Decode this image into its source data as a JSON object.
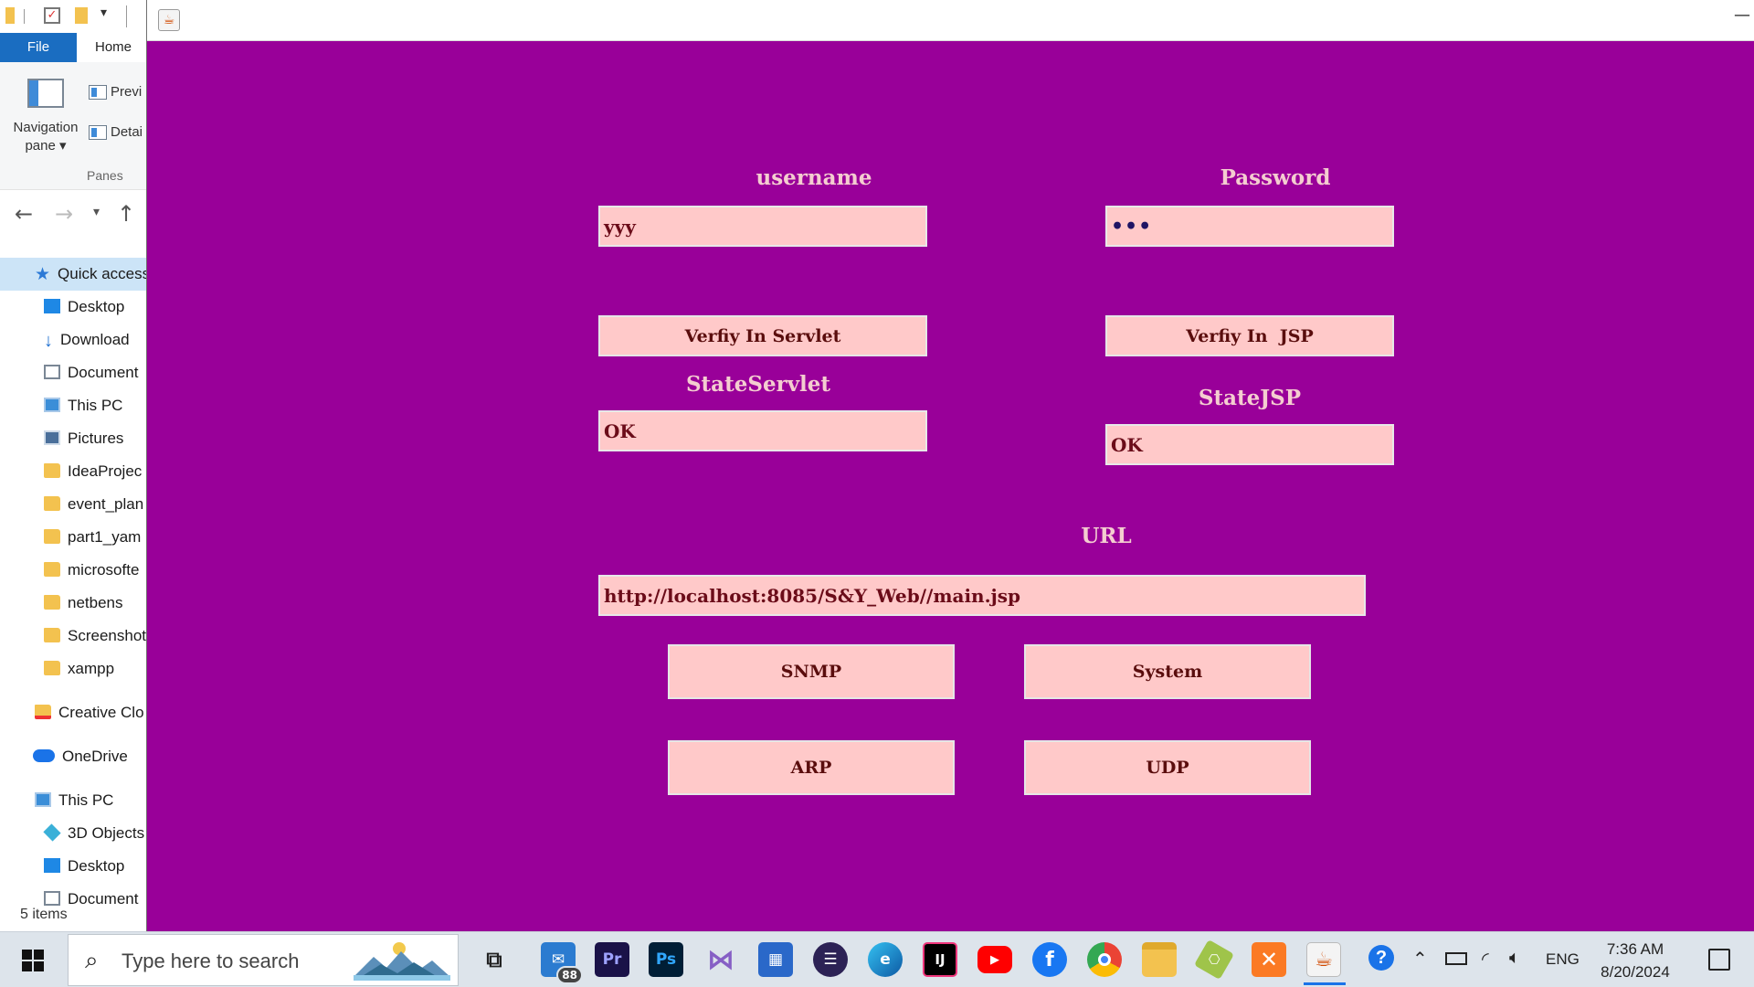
{
  "explorer": {
    "ribbon_tabs": [
      "File",
      "Home"
    ],
    "ribbon": {
      "navigation_pane": "Navigation pane",
      "preview_pane": "Previ",
      "details_pane": "Detai",
      "group_label": "Panes"
    },
    "tree": [
      {
        "label": "Quick access",
        "icon": "star-icon"
      },
      {
        "label": "Desktop",
        "icon": "desktop-icon"
      },
      {
        "label": "Download",
        "icon": "download-icon"
      },
      {
        "label": "Document",
        "icon": "document-icon"
      },
      {
        "label": "This PC",
        "icon": "computer-icon"
      },
      {
        "label": "Pictures",
        "icon": "pictures-icon"
      },
      {
        "label": "IdeaProjec",
        "icon": "folder-icon"
      },
      {
        "label": "event_plan",
        "icon": "folder-icon"
      },
      {
        "label": "part1_yam",
        "icon": "folder-icon"
      },
      {
        "label": "microsofte",
        "icon": "folder-icon"
      },
      {
        "label": "netbens",
        "icon": "folder-icon"
      },
      {
        "label": "Screenshot",
        "icon": "folder-icon"
      },
      {
        "label": "xampp",
        "icon": "folder-icon"
      },
      {
        "label": "Creative Clo",
        "icon": "creative-cloud-icon"
      },
      {
        "label": "OneDrive",
        "icon": "onedrive-icon"
      },
      {
        "label": "This PC",
        "icon": "computer-icon"
      },
      {
        "label": "3D Objects",
        "icon": "3d-objects-icon"
      },
      {
        "label": "Desktop",
        "icon": "desktop-icon"
      },
      {
        "label": "Document",
        "icon": "document-icon"
      }
    ],
    "status": "5 items"
  },
  "app": {
    "username_label": "username",
    "password_label": "Password",
    "username_value": "yyy",
    "password_value": "•••",
    "verify_servlet_button": "Verfiy In Servlet",
    "verify_jsp_button": "Verfiy In  JSP",
    "state_servlet_label": "StateServlet",
    "state_jsp_label": "StateJSP",
    "state_servlet_value": "OK",
    "state_jsp_value": "OK",
    "url_label": "URL",
    "url_value": "http://localhost:8085/S&Y_Web//main.jsp",
    "snmp_button": "SNMP",
    "system_button": "System",
    "arp_button": "ARP",
    "udp_button": "UDP",
    "colors": {
      "background": "#990099",
      "field": "#ffc9c9",
      "label": "#f4cdd0",
      "text": "#6b0c19"
    }
  },
  "taskbar": {
    "search_placeholder": "Type here to search",
    "mail_badge": "88",
    "apps": [
      "task-view-icon",
      "mail-icon",
      "premiere-pro-icon",
      "photoshop-icon",
      "visual-studio-icon",
      "microsoft-store-icon",
      "eclipse-icon",
      "edge-icon",
      "intellij-icon",
      "youtube-icon",
      "facebook-icon",
      "chrome-icon",
      "file-explorer-icon",
      "netbeans-icon",
      "xampp-icon",
      "java-icon"
    ],
    "tray_language": "ENG",
    "time": "7:36 AM",
    "date": "8/20/2024"
  }
}
